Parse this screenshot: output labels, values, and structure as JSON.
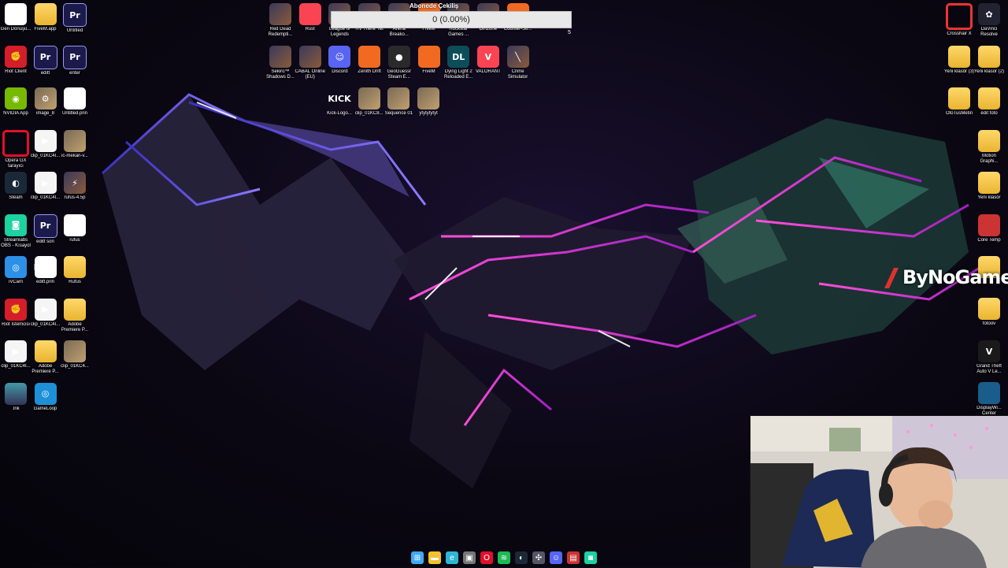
{
  "desktop": {
    "left_icons": [
      {
        "label": "Geri Dönüşü...",
        "glyph": "♻",
        "kind": "g-doc"
      },
      {
        "label": "FiveM.app",
        "glyph": "",
        "kind": "g-folder"
      },
      {
        "label": "Untitled",
        "glyph": "Pr",
        "kind": "g-pr"
      },
      {
        "label": "Riot Client",
        "glyph": "✊",
        "kind": "g-riot"
      },
      {
        "label": "editt",
        "glyph": "Pr",
        "kind": "g-pr"
      },
      {
        "label": "enter",
        "glyph": "Pr",
        "kind": "g-pr"
      },
      {
        "label": "NVIDIA App",
        "glyph": "◉",
        "kind": "g-nvidia"
      },
      {
        "label": "image_8",
        "glyph": "⚙",
        "kind": "g-img"
      },
      {
        "label": "Untitled.prin",
        "glyph": "PRIN",
        "kind": "g-doc"
      },
      {
        "label": "Opera GX tarayıcı",
        "glyph": "",
        "kind": "g-opera"
      },
      {
        "label": "clip_01KC4I...",
        "glyph": "▶",
        "kind": "g-clip"
      },
      {
        "label": "ic-mekan-v...",
        "glyph": "",
        "kind": "g-img"
      },
      {
        "label": "Steam",
        "glyph": "◐",
        "kind": "g-steam"
      },
      {
        "label": "clip_01KC4I...",
        "glyph": "▶",
        "kind": "g-clip"
      },
      {
        "label": "rufus-4.5p",
        "glyph": "⚡",
        "kind": "g-game"
      },
      {
        "label": "Streamlabs OBS - Kısayol",
        "glyph": "◙",
        "kind": "g-obs"
      },
      {
        "label": "editt son",
        "glyph": "Pr",
        "kind": "g-pr"
      },
      {
        "label": "rufus",
        "glyph": "",
        "kind": "g-doc"
      },
      {
        "label": "iVCam",
        "glyph": "◎",
        "kind": "g-ivcam"
      },
      {
        "label": "editt.prin",
        "glyph": "PRIN",
        "kind": "g-doc"
      },
      {
        "label": "Rufus",
        "glyph": "",
        "kind": "g-folder"
      },
      {
        "label": "Riot İstemcisi",
        "glyph": "✊",
        "kind": "g-riot"
      },
      {
        "label": "clip_01KC4I...",
        "glyph": "▶",
        "kind": "g-clip"
      },
      {
        "label": "Adobe Premiere P...",
        "glyph": "",
        "kind": "g-folder"
      },
      {
        "label": "clip_01KC4I...",
        "glyph": "▶",
        "kind": "g-clip"
      },
      {
        "label": "Adobe Premiere P...",
        "glyph": "",
        "kind": "g-folder"
      },
      {
        "label": "clip_01KC4...",
        "glyph": "",
        "kind": "g-img"
      },
      {
        "label": ".lnk",
        "glyph": "",
        "kind": "g-ink"
      },
      {
        "label": "GameLoop",
        "glyph": "◎",
        "kind": "g-gameloop"
      }
    ],
    "top_icons": [
      {
        "label": "Red Dead Redempti...",
        "glyph": "",
        "kind": "g-game"
      },
      {
        "label": "Rust",
        "glyph": "",
        "kind": "g-val"
      },
      {
        "label": "League of Legends",
        "glyph": "",
        "kind": "g-game"
      },
      {
        "label": "RV There Yet",
        "glyph": "",
        "kind": "g-game"
      },
      {
        "label": "Arena Breako...",
        "glyph": "",
        "kind": "g-game"
      },
      {
        "label": "FiveM",
        "glyph": "",
        "kind": "g-fivem"
      },
      {
        "label": "Rockstar Games ...",
        "glyph": "",
        "kind": "g-game"
      },
      {
        "label": "Dirtzone",
        "glyph": "",
        "kind": "g-game"
      },
      {
        "label": "Counter-Str...",
        "glyph": "",
        "kind": "g-fivem"
      },
      {
        "label": "Sekiro™ Shadows D...",
        "glyph": "",
        "kind": "g-game"
      },
      {
        "label": "CABAL Online (EU)",
        "glyph": "",
        "kind": "g-game"
      },
      {
        "label": "Discord",
        "glyph": "☺",
        "kind": "g-discord"
      },
      {
        "label": "Zenith Drift",
        "glyph": "",
        "kind": "g-fivem"
      },
      {
        "label": "GeoGuessr Steam E...",
        "glyph": "●",
        "kind": "g-geo"
      },
      {
        "label": "FiveM",
        "glyph": "",
        "kind": "g-fivem"
      },
      {
        "label": "Dying Light 2 Reloaded E...",
        "glyph": "DL",
        "kind": "g-dl"
      },
      {
        "label": "VALORANT",
        "glyph": "V",
        "kind": "g-val"
      },
      {
        "label": "Crime Simulator",
        "glyph": "╲",
        "kind": "g-game"
      },
      {
        "label": "Kick-Logo...",
        "glyph": "KICK",
        "kind": "g-kick"
      },
      {
        "label": "clip_01KC8...",
        "glyph": "",
        "kind": "g-img"
      },
      {
        "label": "Sequence 01",
        "glyph": "",
        "kind": "g-img"
      },
      {
        "label": "ytytytytyt",
        "glyph": "",
        "kind": "g-img"
      }
    ],
    "right_icons": [
      {
        "label": "Crosshair X",
        "glyph": "",
        "kind": "g-crosshair"
      },
      {
        "label": "DaVinci Resolve",
        "glyph": "✿",
        "kind": "g-davinci"
      },
      {
        "label": "Yeni klasör (3)",
        "glyph": "",
        "kind": "g-folder"
      },
      {
        "label": "Yeni klasör (2)",
        "glyph": "",
        "kind": "g-folder"
      },
      {
        "label": "OtoTusMetin",
        "glyph": "",
        "kind": "g-folder"
      },
      {
        "label": "edit foto",
        "glyph": "",
        "kind": "g-folder"
      },
      {
        "label": "Motion Graphi...",
        "glyph": "",
        "kind": "g-folder"
      },
      {
        "label": "Yeni klasör",
        "glyph": "",
        "kind": "g-folder"
      },
      {
        "label": "Core Temp",
        "glyph": "",
        "kind": "g-coretemp"
      },
      {
        "label": "",
        "glyph": "",
        "kind": "g-folder"
      },
      {
        "label": "fotoov",
        "glyph": "",
        "kind": "g-folder"
      },
      {
        "label": "Grand Theft Auto V Le...",
        "glyph": "V",
        "kind": "g-gta"
      },
      {
        "label": "DisplayWi... Center",
        "glyph": "",
        "kind": "g-display"
      }
    ]
  },
  "popup": {
    "title": "Abonede Çekiliş",
    "progress_text": "0 (0.00%)",
    "progress_value": 0,
    "count": "5"
  },
  "overlay": {
    "watermark": "ByNoGame"
  },
  "taskbar": {
    "items": [
      {
        "name": "start-icon",
        "glyph": "⊞",
        "color": "#3fa9f5"
      },
      {
        "name": "file-explorer-icon",
        "glyph": "▬",
        "color": "#f2c230"
      },
      {
        "name": "edge-icon",
        "glyph": "e",
        "color": "#2fb6d6"
      },
      {
        "name": "store-icon",
        "glyph": "▣",
        "color": "#777"
      },
      {
        "name": "opera-gx-icon",
        "glyph": "O",
        "color": "#e0102a"
      },
      {
        "name": "spotify-icon",
        "glyph": "≋",
        "color": "#1db954"
      },
      {
        "name": "steam-icon",
        "glyph": "◐",
        "color": "#1b2838"
      },
      {
        "name": "network-icon",
        "glyph": "✣",
        "color": "#556"
      },
      {
        "name": "discord-icon",
        "glyph": "☺",
        "color": "#5865f2"
      },
      {
        "name": "app-red-icon",
        "glyph": "▤",
        "color": "#c33"
      },
      {
        "name": "obs-icon",
        "glyph": "◙",
        "color": "#1dd1a1"
      }
    ]
  }
}
